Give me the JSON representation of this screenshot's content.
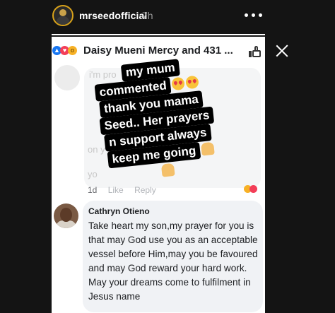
{
  "story": {
    "username": "mrseedofficial",
    "time_ago": "7h",
    "progress": 1.0
  },
  "fb_post": {
    "reactors": "Daisy Mueni Mercy and 431 ...",
    "faded_lines": [
      "i'm pro",
      "on y",
      "yo"
    ],
    "meta": {
      "age": "1d",
      "like": "Like",
      "reply": "Reply"
    }
  },
  "sticker": {
    "lines": [
      "my mum",
      "commented",
      "thank you mama",
      "Seed.. Her prayers",
      "n support always",
      "keep me going"
    ]
  },
  "comment": {
    "author": "Cathryn Otieno",
    "text": "Take heart my son,my prayer for you is that may God use you as an acceptable vessel before Him,may you be favoured  and may God reward your hard work. May your dreams come to fulfilment in Jesus name"
  },
  "icons": {
    "more": "more-dots-icon",
    "close": "close-icon",
    "like": "thumbs-up-icon"
  },
  "colors": {
    "story_bg": "#141414",
    "avatar_ring": "#d8a21a",
    "fb_blue": "#1877f2",
    "bubble": "#f0f2f5"
  }
}
